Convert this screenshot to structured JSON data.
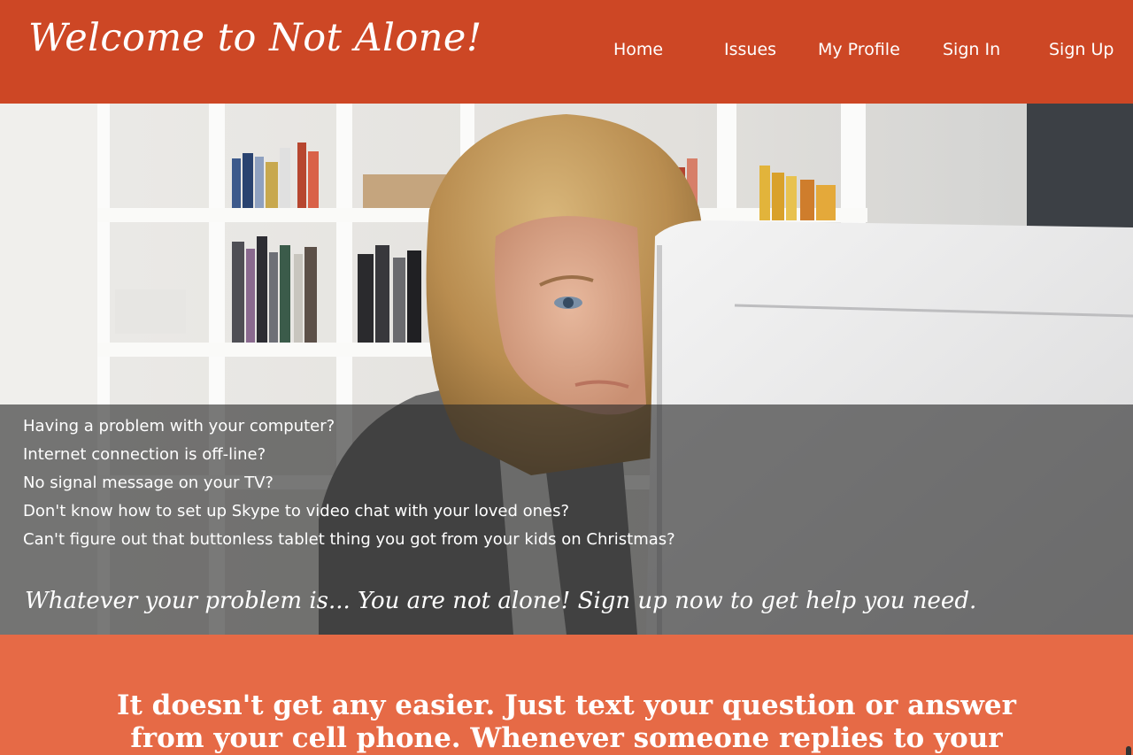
{
  "header": {
    "title": "Welcome to Not Alone!",
    "nav": [
      "Home",
      "Issues",
      "My Profile",
      "Sign In",
      "Sign Up"
    ]
  },
  "hero": {
    "image": "woman-frowning-at-computer-monitor",
    "problems": [
      "Having a problem with your computer?",
      "Internet connection is off-line?",
      "No signal message on your TV?",
      "Don't know how to set up Skype to video chat with your loved ones?",
      "Can't figure out that buttonless tablet thing you got from your kids on Christmas?"
    ],
    "tagline": "Whatever your problem is... You are not alone! Sign up now to get help you need."
  },
  "band": {
    "text": "It doesn't get any easier. Just text your question or answer from your cell phone. Whenever someone replies to your"
  },
  "colors": {
    "header_bg": "#cd4725",
    "band_bg": "#e66a46",
    "text": "#ffffff"
  }
}
